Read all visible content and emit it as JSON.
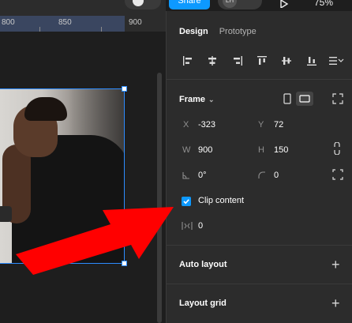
{
  "ruler": {
    "marks": [
      "800",
      "850",
      "900"
    ]
  },
  "topbar": {
    "share_label": "Share",
    "user_initials": "LH",
    "zoom_label": "75%"
  },
  "panel": {
    "tabs": [
      {
        "label": "Design",
        "active": true
      },
      {
        "label": "Prototype",
        "active": false
      }
    ],
    "align_icons": [
      "align-left-icon",
      "align-horizontal-center-icon",
      "align-right-icon",
      "align-top-icon",
      "align-vertical-center-icon",
      "align-bottom-icon",
      "distribute-icon"
    ],
    "frame": {
      "title": "Frame",
      "x_label": "X",
      "x_value": "-323",
      "y_label": "Y",
      "y_value": "72",
      "w_label": "W",
      "w_value": "900",
      "h_label": "H",
      "h_value": "150",
      "rotation_value": "0°",
      "radius_value": "0",
      "clip_label": "Clip content",
      "clip_checked": true,
      "spacing_value": "0"
    },
    "auto_layout_label": "Auto layout",
    "layout_grid_label": "Layout grid"
  },
  "colors": {
    "accent": "#0d99ff",
    "selection": "#2d8cff",
    "arrow": "#ff0000"
  }
}
